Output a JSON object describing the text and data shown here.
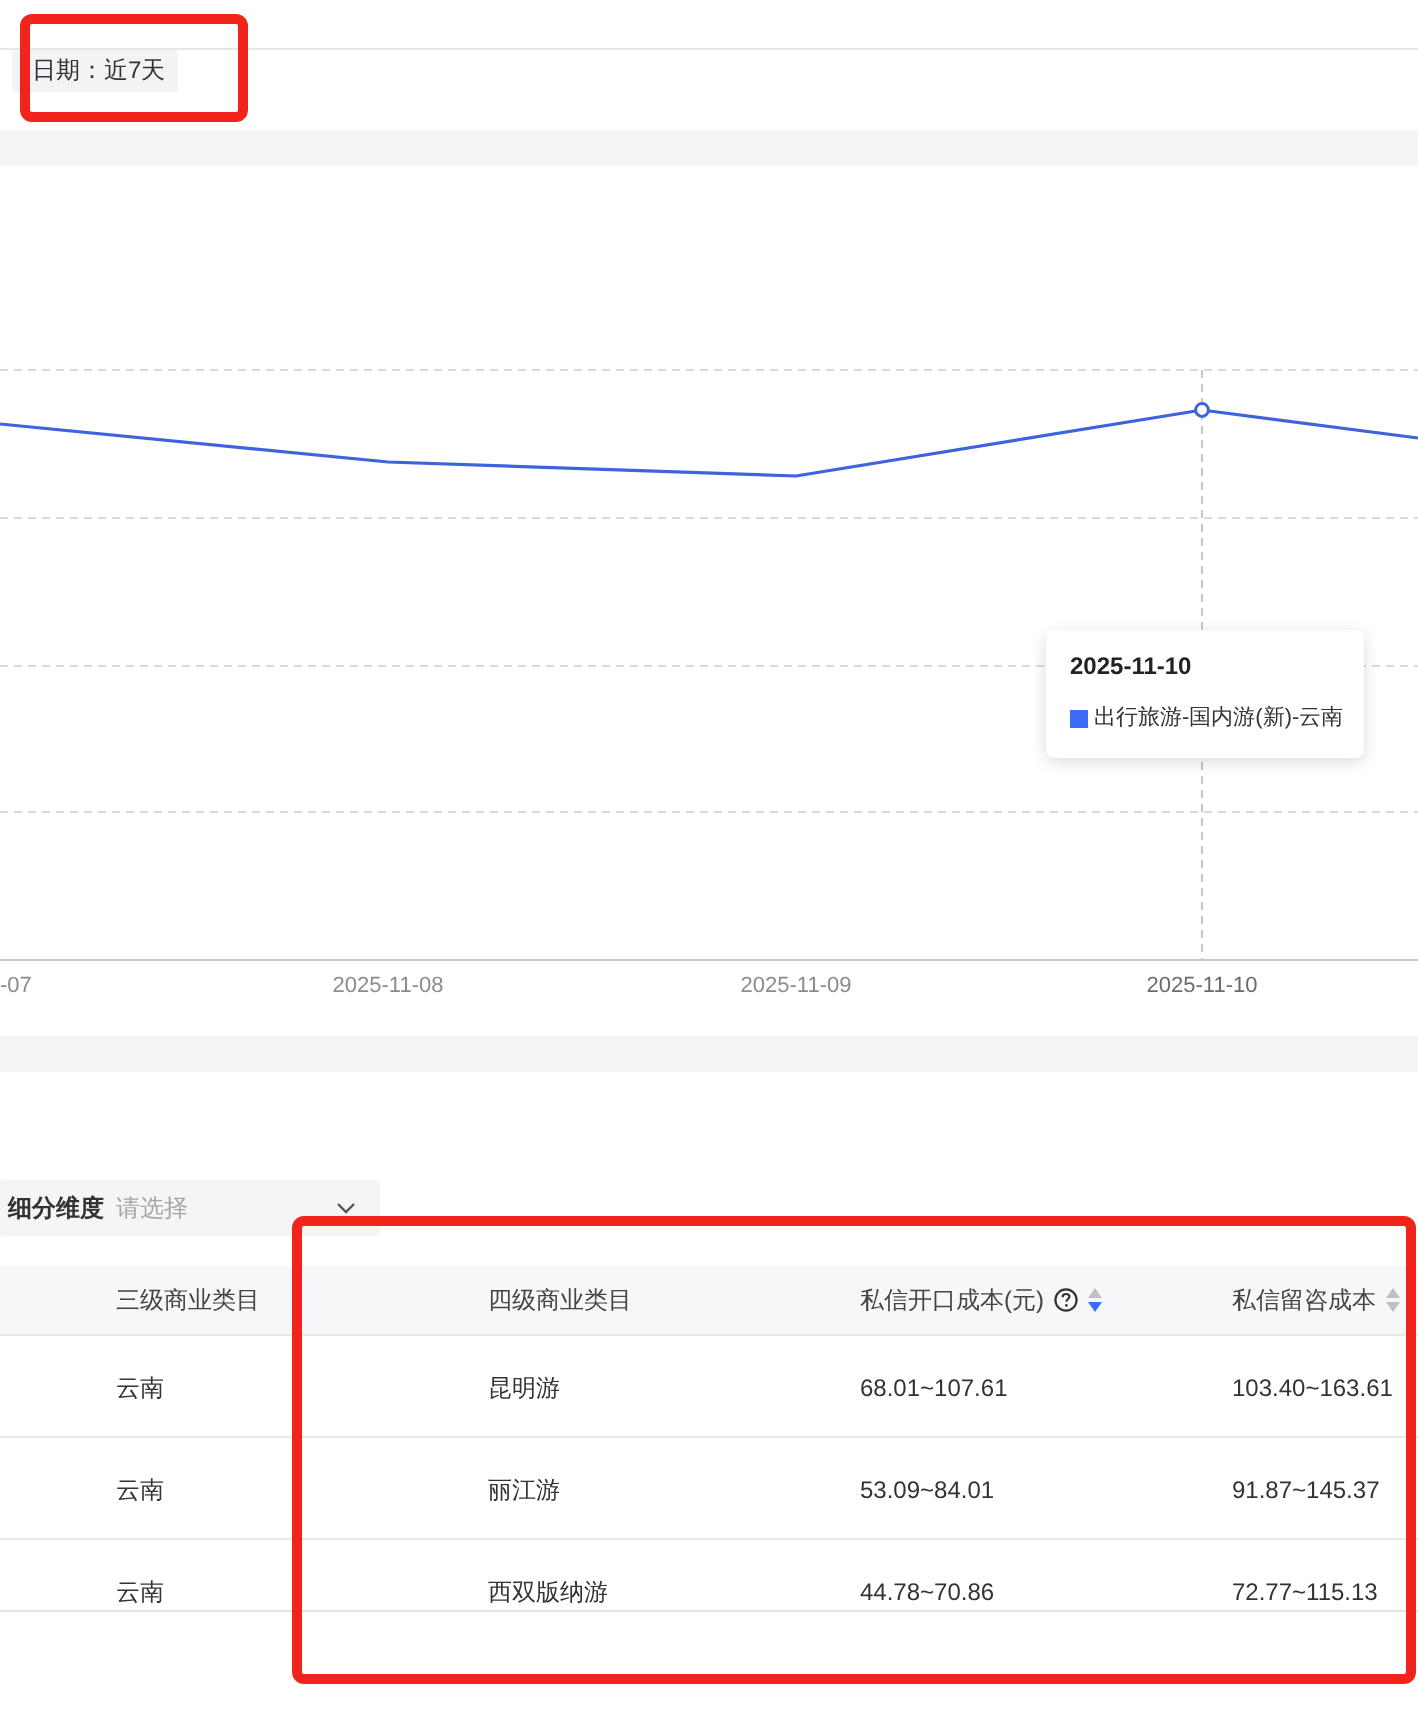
{
  "date_filter": {
    "label": "日期：近7天"
  },
  "trend_chart": {
    "x_axis": [
      {
        "label": "-07",
        "hovered": false
      },
      {
        "label": "2025-11-08",
        "hovered": false
      },
      {
        "label": "2025-11-09",
        "hovered": false
      },
      {
        "label": "2025-11-10",
        "hovered": true
      }
    ],
    "tooltip": {
      "title": "2025-11-10",
      "series": "出行旅游-国内游(新)-云南"
    }
  },
  "dimension_filter": {
    "label": "细分维度",
    "placeholder": "请选择"
  },
  "table": {
    "columns": [
      {
        "label": "三级商业类目",
        "help": false,
        "sortable": false
      },
      {
        "label": "四级商业类目",
        "help": false,
        "sortable": false
      },
      {
        "label": "私信开口成本(元)",
        "help": true,
        "sortable": true,
        "sorted_desc": true
      },
      {
        "label": "私信留咨成本",
        "help": false,
        "sortable": true,
        "sorted_desc": false
      }
    ],
    "rows": [
      [
        "云南",
        "昆明游",
        "68.01~107.61",
        "103.40~163.61"
      ],
      [
        "云南",
        "丽江游",
        "53.09~84.01",
        "91.87~145.37"
      ],
      [
        "云南",
        "西双版纳游",
        "44.78~70.86",
        "72.77~115.13"
      ]
    ]
  }
}
